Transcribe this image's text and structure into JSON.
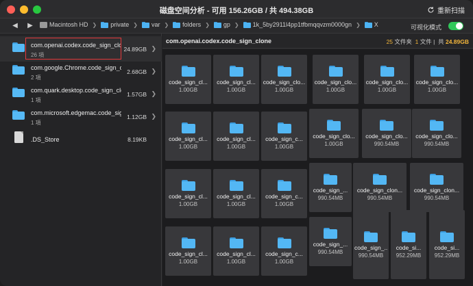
{
  "window": {
    "title": "磁盘空间分析 - 可用 156.26GB / 共 494.38GB",
    "rescan_label": "重新扫描"
  },
  "pathbar": {
    "crumbs": [
      "Macintosh HD",
      "private",
      "var",
      "folders",
      "gp",
      "1k_5by2911l4pp1tfbmqqvzm0000gn",
      "X"
    ],
    "viz_label": "可视化模式",
    "viz_on": true
  },
  "list": {
    "items": [
      {
        "name": "com.openai.codex.code_sign_clone",
        "count": "26 項",
        "size": "24.89GB",
        "type": "folder",
        "selected": true
      },
      {
        "name": "com.google.Chrome.code_sign_clone",
        "count": "2 項",
        "size": "2.68GB",
        "type": "folder"
      },
      {
        "name": "com.quark.desktop.code_sign_clone",
        "count": "1 項",
        "size": "1.57GB",
        "type": "folder"
      },
      {
        "name": "com.microsoft.edgemac.code_sign_clone",
        "count": "1 項",
        "size": "1.12GB",
        "type": "folder"
      },
      {
        "name": ".DS_Store",
        "count": "",
        "size": "8.19KB",
        "type": "file"
      }
    ]
  },
  "detail": {
    "name": "com.openai.codex.code_sign_clone",
    "folders_num": "25",
    "folders_label": "文件夹",
    "files_num": "1",
    "files_label": "文件",
    "total_prefix": "共",
    "total": "24.89GB",
    "tiles": [
      {
        "name": "code_sign_cl...",
        "size": "1.00GB"
      },
      {
        "name": "code_sign_cl...",
        "size": "1.00GB"
      },
      {
        "name": "code_sign_clo...",
        "size": "1.00GB"
      },
      {
        "name": "code_sign_clo...",
        "size": "1.00GB"
      },
      {
        "name": "code_sign_clo...",
        "size": "1.00GB"
      },
      {
        "name": "code_sign_clo...",
        "size": "1.00GB"
      },
      {
        "name": "code_sign_cl...",
        "size": "1.00GB"
      },
      {
        "name": "code_sign_cl...",
        "size": "1.00GB"
      },
      {
        "name": "code_sign_c...",
        "size": "1.00GB"
      },
      {
        "name": "code_sign_clo...",
        "size": "1.00GB"
      },
      {
        "name": "code_sign_clo...",
        "size": "990.54MB"
      },
      {
        "name": "code_sign_clo...",
        "size": "990.54MB"
      },
      {
        "name": "code_sign_cl...",
        "size": "1.00GB"
      },
      {
        "name": "code_sign_cl...",
        "size": "1.00GB"
      },
      {
        "name": "code_sign_c...",
        "size": "1.00GB"
      },
      {
        "name": "code_sign_...",
        "size": "990.54MB"
      },
      {
        "name": "code_sign_clon...",
        "size": "990.54MB"
      },
      {
        "name": "code_sign_clon...",
        "size": "990.54MB"
      },
      {
        "name": "code_sign_cl...",
        "size": "1.00GB"
      },
      {
        "name": "code_sign_cl...",
        "size": "1.00GB"
      },
      {
        "name": "code_sign_c...",
        "size": "1.00GB"
      },
      {
        "name": "code_sign_...",
        "size": "990.54MB"
      },
      {
        "name": "code_sign_...",
        "size": "990.54MB"
      },
      {
        "name": "code_si...",
        "size": "952.29MB"
      },
      {
        "name": "code_si...",
        "size": "952.29MB"
      }
    ]
  }
}
